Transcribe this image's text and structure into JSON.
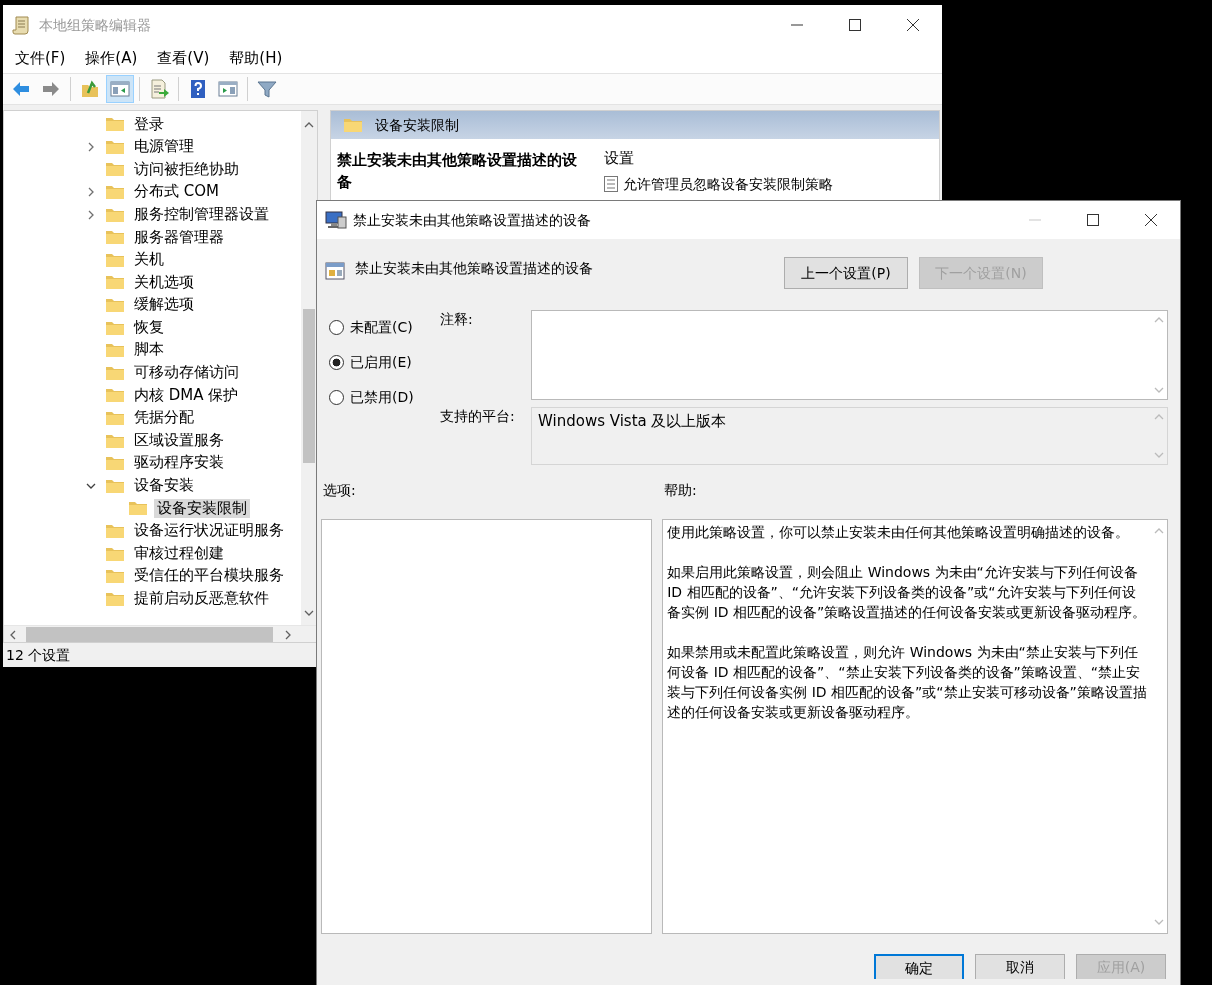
{
  "main_window": {
    "title": "本地组策略编辑器",
    "menu": [
      "文件(F)",
      "操作(A)",
      "查看(V)",
      "帮助(H)"
    ],
    "toolbar": [
      {
        "kind": "back",
        "pressed": false,
        "disabled": false
      },
      {
        "kind": "forward",
        "pressed": false,
        "disabled": true
      },
      {
        "kind": "up",
        "pressed": false,
        "disabled": false
      },
      {
        "kind": "tree",
        "pressed": true,
        "disabled": false
      },
      {
        "kind": "export",
        "pressed": false,
        "disabled": false
      },
      {
        "kind": "help",
        "pressed": false,
        "disabled": false
      },
      {
        "kind": "action_pane",
        "pressed": false,
        "disabled": false
      },
      {
        "kind": "filter",
        "pressed": false,
        "disabled": false
      }
    ],
    "tree": [
      {
        "label": "登录",
        "expandable": false,
        "expanded": false,
        "selected": false
      },
      {
        "label": "电源管理",
        "expandable": true,
        "expanded": false,
        "selected": false
      },
      {
        "label": "访问被拒绝协助",
        "expandable": false,
        "expanded": false,
        "selected": false
      },
      {
        "label": "分布式 COM",
        "expandable": true,
        "expanded": false,
        "selected": false
      },
      {
        "label": "服务控制管理器设置",
        "expandable": true,
        "expanded": false,
        "selected": false
      },
      {
        "label": "服务器管理器",
        "expandable": false,
        "expanded": false,
        "selected": false
      },
      {
        "label": "关机",
        "expandable": false,
        "expanded": false,
        "selected": false
      },
      {
        "label": "关机选项",
        "expandable": false,
        "expanded": false,
        "selected": false
      },
      {
        "label": "缓解选项",
        "expandable": false,
        "expanded": false,
        "selected": false
      },
      {
        "label": "恢复",
        "expandable": false,
        "expanded": false,
        "selected": false
      },
      {
        "label": "脚本",
        "expandable": false,
        "expanded": false,
        "selected": false
      },
      {
        "label": "可移动存储访问",
        "expandable": false,
        "expanded": false,
        "selected": false
      },
      {
        "label": "内核 DMA 保护",
        "expandable": false,
        "expanded": false,
        "selected": false
      },
      {
        "label": "凭据分配",
        "expandable": false,
        "expanded": false,
        "selected": false
      },
      {
        "label": "区域设置服务",
        "expandable": false,
        "expanded": false,
        "selected": false
      },
      {
        "label": "驱动程序安装",
        "expandable": false,
        "expanded": false,
        "selected": false
      },
      {
        "label": "设备安装",
        "expandable": true,
        "expanded": true,
        "selected": false,
        "children": [
          {
            "label": "设备安装限制",
            "expandable": false,
            "expanded": false,
            "selected": true
          }
        ]
      },
      {
        "label": "设备运行状况证明服务",
        "expandable": false,
        "expanded": false,
        "selected": false
      },
      {
        "label": "审核过程创建",
        "expandable": false,
        "expanded": false,
        "selected": false
      },
      {
        "label": "受信任的平台模块服务",
        "expandable": false,
        "expanded": false,
        "selected": false
      },
      {
        "label": "提前启动反恶意软件",
        "expandable": false,
        "expanded": false,
        "selected": false
      }
    ],
    "pane": {
      "header": "设备安装限制",
      "policy_title": "禁止安装未由其他策略设置描述的设备",
      "column": "设置",
      "rows": [
        "允许管理员忽略设备安装限制策略"
      ]
    },
    "status_bar": "12 个设置"
  },
  "dialog": {
    "title": "禁止安装未由其他策略设置描述的设备",
    "policy_name": "禁止安装未由其他策略设置描述的设备",
    "nav_buttons": [
      {
        "label": "上一个设置(P)",
        "disabled": false
      },
      {
        "label": "下一个设置(N)",
        "disabled": true
      }
    ],
    "states": [
      {
        "label": "未配置(C)",
        "selected": false
      },
      {
        "label": "已启用(E)",
        "selected": true
      },
      {
        "label": "已禁用(D)",
        "selected": false
      }
    ],
    "comment_label": "注释:",
    "platform_label": "支持的平台:",
    "platform": "Windows Vista 及以上版本",
    "options_label": "选项:",
    "help_label": "帮助:",
    "help": [
      "使用此策略设置，你可以禁止安装未由任何其他策略设置明确描述的设备。",
      "如果启用此策略设置，则会阻止 Windows 为未由“允许安装与下列任何设备 ID 相匹配的设备”、“允许安装下列设备类的设备”或“允许安装与下列任何设备实例 ID 相匹配的设备”策略设置描述的任何设备安装或更新设备驱动程序。",
      "如果禁用或未配置此策略设置，则允许 Windows 为未由“禁止安装与下列任何设备 ID 相匹配的设备”、“禁止安装下列设备类的设备”策略设置、“禁止安装与下列任何设备实例 ID 相匹配的设备”或“禁止安装可移动设备”策略设置描述的任何设备安装或更新设备驱动程序。"
    ],
    "buttons": [
      {
        "label": "确定",
        "default": true,
        "disabled": false
      },
      {
        "label": "取消",
        "default": false,
        "disabled": false
      },
      {
        "label": "应用(A)",
        "default": false,
        "disabled": true
      }
    ]
  }
}
